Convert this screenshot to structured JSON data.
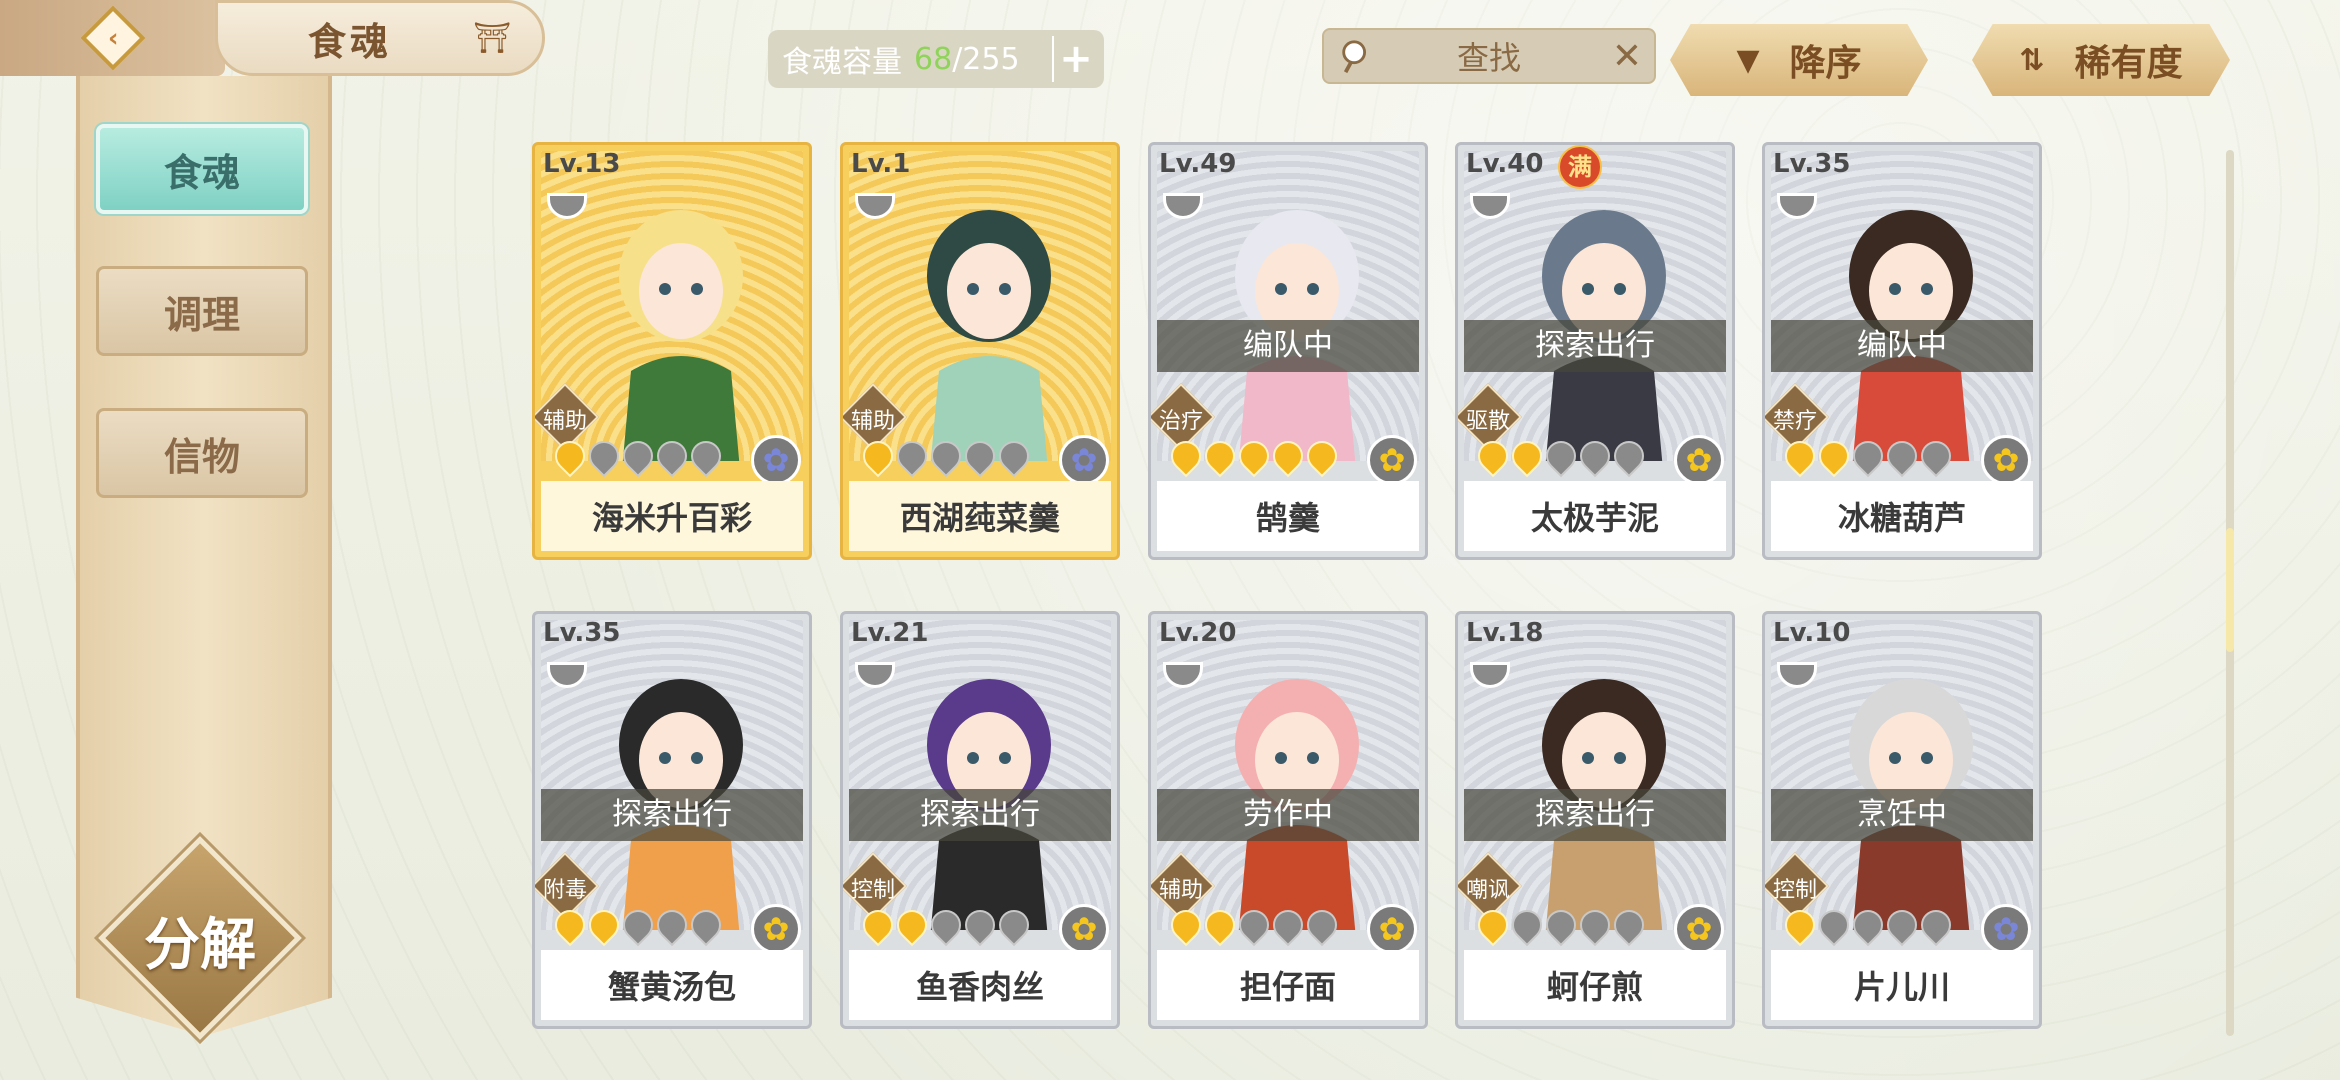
{
  "header": {
    "title": "食魂",
    "capacity_label": "食魂容量",
    "capacity_current": "68",
    "capacity_max": "/255",
    "capacity_add": "+",
    "search_placeholder": "查找",
    "search_clear": "✕",
    "sort_order_label": "降序",
    "sort_rarity_label": "稀有度"
  },
  "sidebar": {
    "items": [
      {
        "label": "食魂",
        "active": true
      },
      {
        "label": "调理",
        "active": false
      },
      {
        "label": "信物",
        "active": false
      }
    ],
    "decompose_label": "分解"
  },
  "cards": [
    {
      "level": "Lv.13",
      "name": "海米升百彩",
      "role": "辅助",
      "status": "",
      "stars_on": 1,
      "flower": "blue",
      "gold": true,
      "max": false
    },
    {
      "level": "Lv.1",
      "name": "西湖莼菜羹",
      "role": "辅助",
      "status": "",
      "stars_on": 1,
      "flower": "blue",
      "gold": true,
      "max": false
    },
    {
      "level": "Lv.49",
      "name": "鹄羹",
      "role": "治疗",
      "status": "编队中",
      "stars_on": 5,
      "flower": "gold",
      "gold": false,
      "max": false
    },
    {
      "level": "Lv.40",
      "name": "太极芋泥",
      "role": "驱散",
      "status": "探索出行",
      "stars_on": 2,
      "flower": "gold",
      "gold": false,
      "max": true,
      "max_label": "满"
    },
    {
      "level": "Lv.35",
      "name": "冰糖葫芦",
      "role": "禁疗",
      "status": "编队中",
      "stars_on": 2,
      "flower": "gold",
      "gold": false,
      "max": false
    },
    {
      "level": "Lv.35",
      "name": "蟹黄汤包",
      "role": "附毒",
      "status": "探索出行",
      "stars_on": 2,
      "flower": "gold",
      "gold": false,
      "max": false
    },
    {
      "level": "Lv.21",
      "name": "鱼香肉丝",
      "role": "控制",
      "status": "探索出行",
      "stars_on": 2,
      "flower": "gold",
      "gold": false,
      "max": false
    },
    {
      "level": "Lv.20",
      "name": "担仔面",
      "role": "辅助",
      "status": "劳作中",
      "stars_on": 2,
      "flower": "gold",
      "gold": false,
      "max": false
    },
    {
      "level": "Lv.18",
      "name": "蚵仔煎",
      "role": "嘲讽",
      "status": "探索出行",
      "stars_on": 1,
      "flower": "gold",
      "gold": false,
      "max": false
    },
    {
      "level": "Lv.10",
      "name": "片儿川",
      "role": "控制",
      "status": "烹饪中",
      "stars_on": 1,
      "flower": "blue",
      "gold": false,
      "max": false
    }
  ]
}
